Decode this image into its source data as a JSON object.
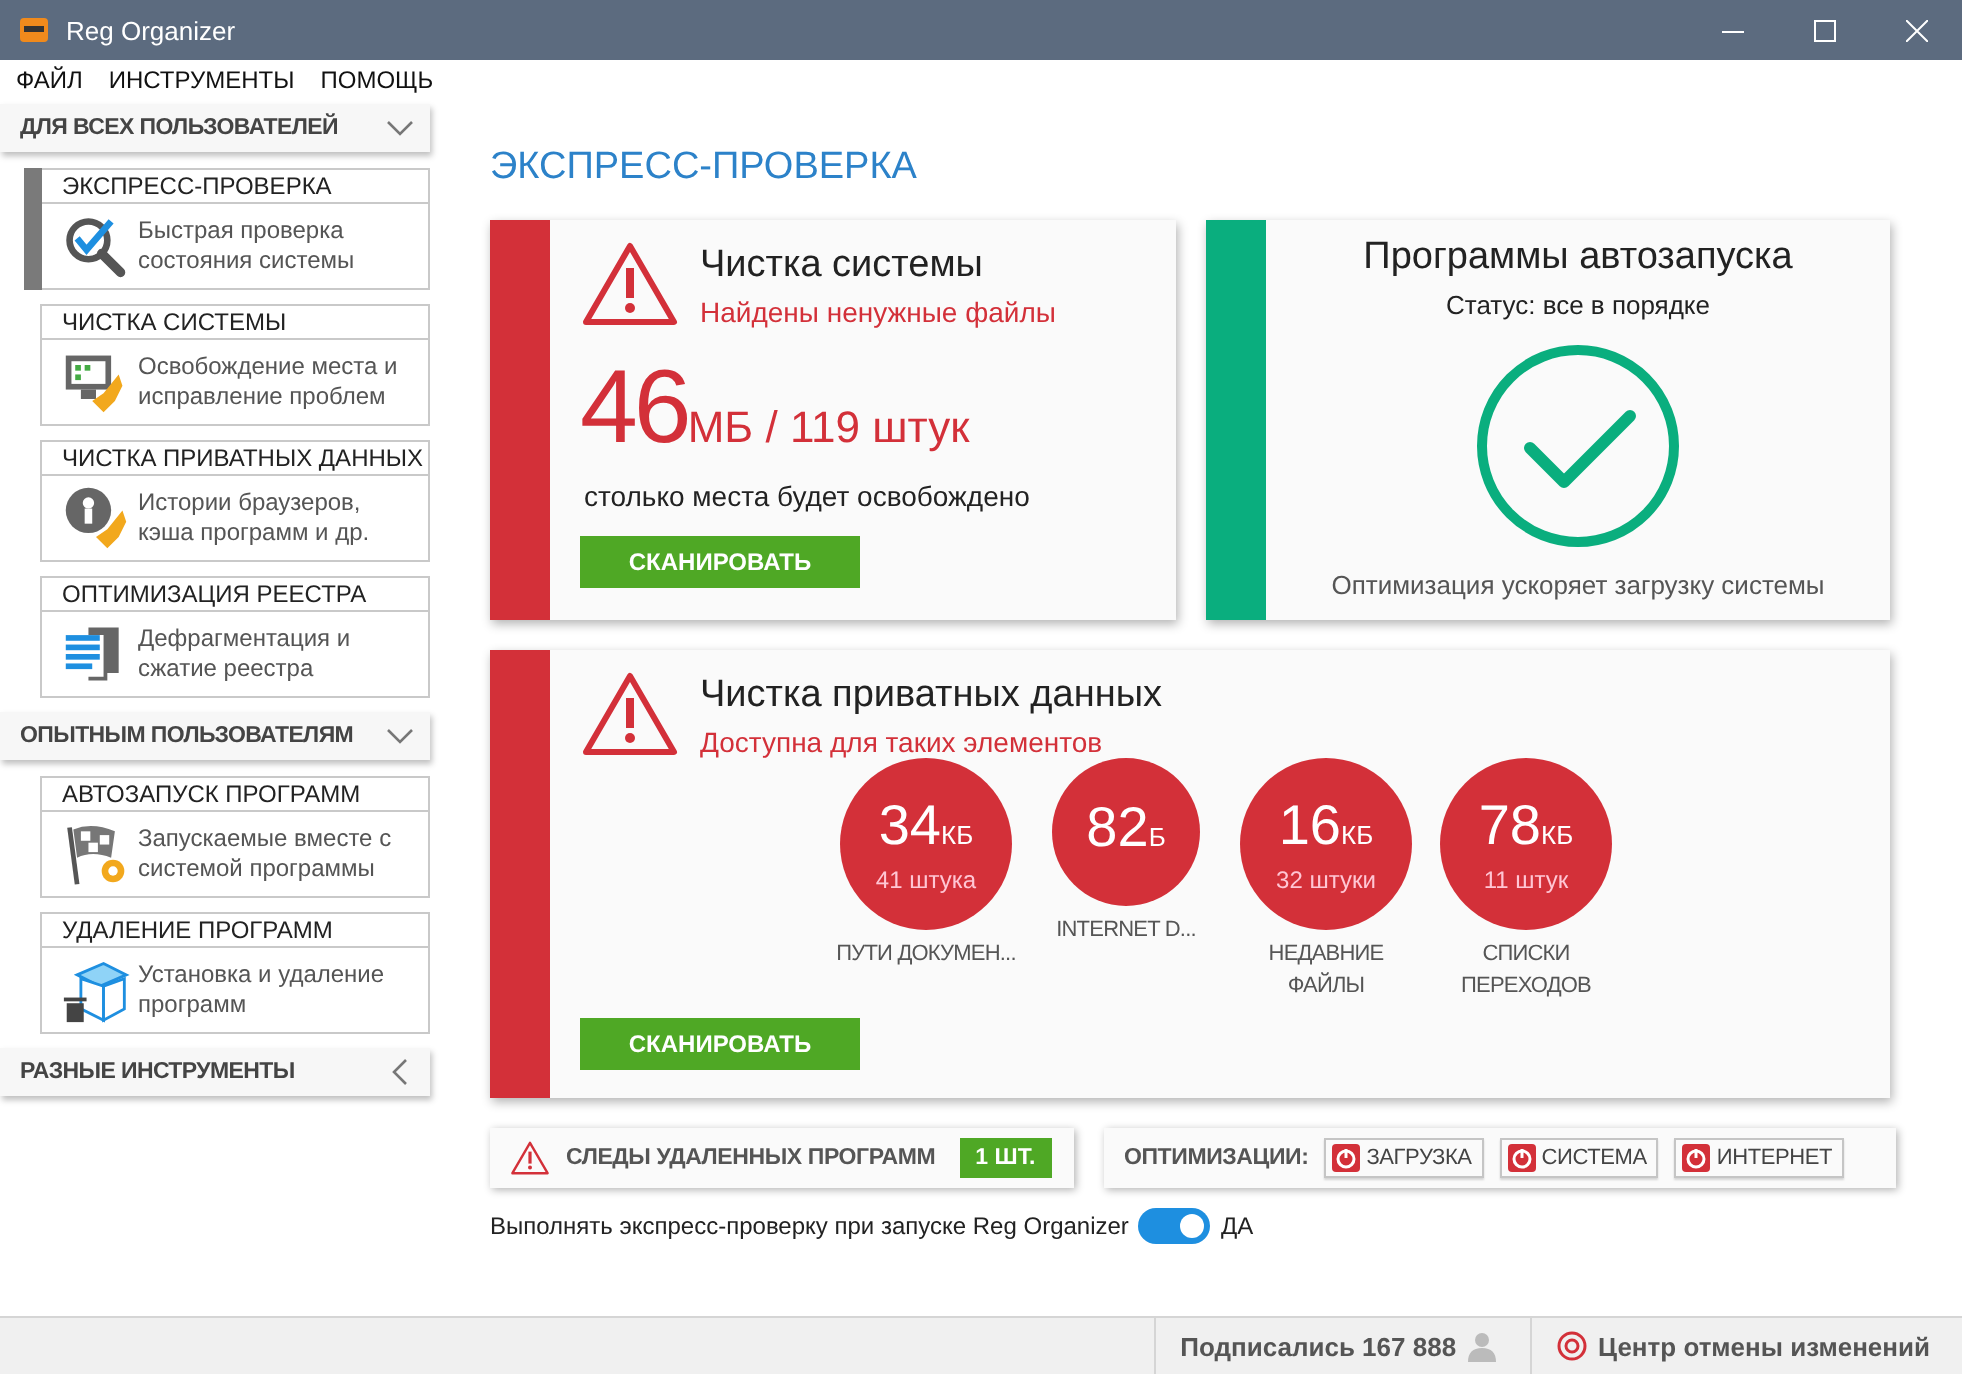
{
  "window": {
    "title": "Reg Organizer"
  },
  "menu": [
    "ФАЙЛ",
    "ИНСТРУМЕНТЫ",
    "ПОМОЩЬ"
  ],
  "sidebar": {
    "sections": [
      {
        "label": "ДЛЯ ВСЕХ ПОЛЬЗОВАТЕЛЕЙ",
        "expanded": true,
        "items": [
          {
            "title": "ЭКСПРЕСС-ПРОВЕРКА",
            "description": "Быстрая проверка состояния системы",
            "kind": "check",
            "selected": true
          },
          {
            "title": "ЧИСТКА СИСТЕМЫ",
            "description": "Освобождение места и исправление проблем",
            "kind": "monitor",
            "selected": false
          },
          {
            "title": "ЧИСТКА ПРИВАТНЫХ ДАННЫХ",
            "description": "Истории браузеров, кэша программ и др.",
            "kind": "privacy",
            "selected": false
          },
          {
            "title": "ОПТИМИЗАЦИЯ РЕЕСТРА",
            "description": "Дефрагментация и сжатие реестра",
            "kind": "registry",
            "selected": false
          }
        ]
      },
      {
        "label": "ОПЫТНЫМ ПОЛЬЗОВАТЕЛЯМ",
        "expanded": true,
        "items": [
          {
            "title": "АВТОЗАПУСК ПРОГРАММ",
            "description": "Запускаемые вместе с системой программы",
            "kind": "flag",
            "selected": false
          },
          {
            "title": "УДАЛЕНИЕ ПРОГРАММ",
            "description": "Установка и удаление программ",
            "kind": "box",
            "selected": false
          }
        ]
      },
      {
        "label": "РАЗНЫЕ ИНСТРУМЕНТЫ",
        "expanded": false
      }
    ]
  },
  "main": {
    "heading": "ЭКСПРЕСС-ПРОВЕРКА",
    "system_cleanup": {
      "kind": "warning",
      "title": "Чистка системы",
      "subtitle": "Найдены ненужные файлы",
      "value": "46",
      "unit": "МБ / 119 штук",
      "note": "столько места будет освобождено",
      "button": "СКАНИРОВАТЬ"
    },
    "autorun": {
      "kind": "ok",
      "title": "Программы автозапуска",
      "subtitle": "Статус: все в порядке",
      "note": "Оптимизация ускоряет загрузку системы"
    },
    "private_data": {
      "kind": "warning",
      "title": "Чистка приватных данных",
      "subtitle": "Доступна для таких элементов",
      "button": "СКАНИРОВАТЬ",
      "items": [
        {
          "value": "34",
          "unit": "КБ",
          "count": "41 штука",
          "label": "ПУТИ ДОКУМЕН..."
        },
        {
          "value": "82",
          "unit": "Б",
          "label": "INTERNET D..."
        },
        {
          "value": "16",
          "unit": "КБ",
          "count": "32 штуки",
          "label": "НЕДАВНИЕ ФАЙЛЫ"
        },
        {
          "value": "78",
          "unit": "КБ",
          "count": "11 штук",
          "label": "СПИСКИ ПЕРЕХОДОВ"
        }
      ]
    },
    "leftovers": {
      "label": "СЛЕДЫ УДАЛЕННЫХ ПРОГРАММ",
      "badge": "1 ШТ."
    },
    "optimizations": {
      "label": "ОПТИМИЗАЦИИ:",
      "buttons": [
        "ЗАГРУЗКА",
        "СИСТЕМА",
        "ИНТЕРНЕТ"
      ]
    },
    "startup_toggle": {
      "label": "Выполнять экспресс-проверку при запуске Reg Organizer",
      "on": true,
      "value": "ДА"
    }
  },
  "status_bar": {
    "subscribers": "Подписались 167 888",
    "undo_center": "Центр отмены изменений"
  }
}
